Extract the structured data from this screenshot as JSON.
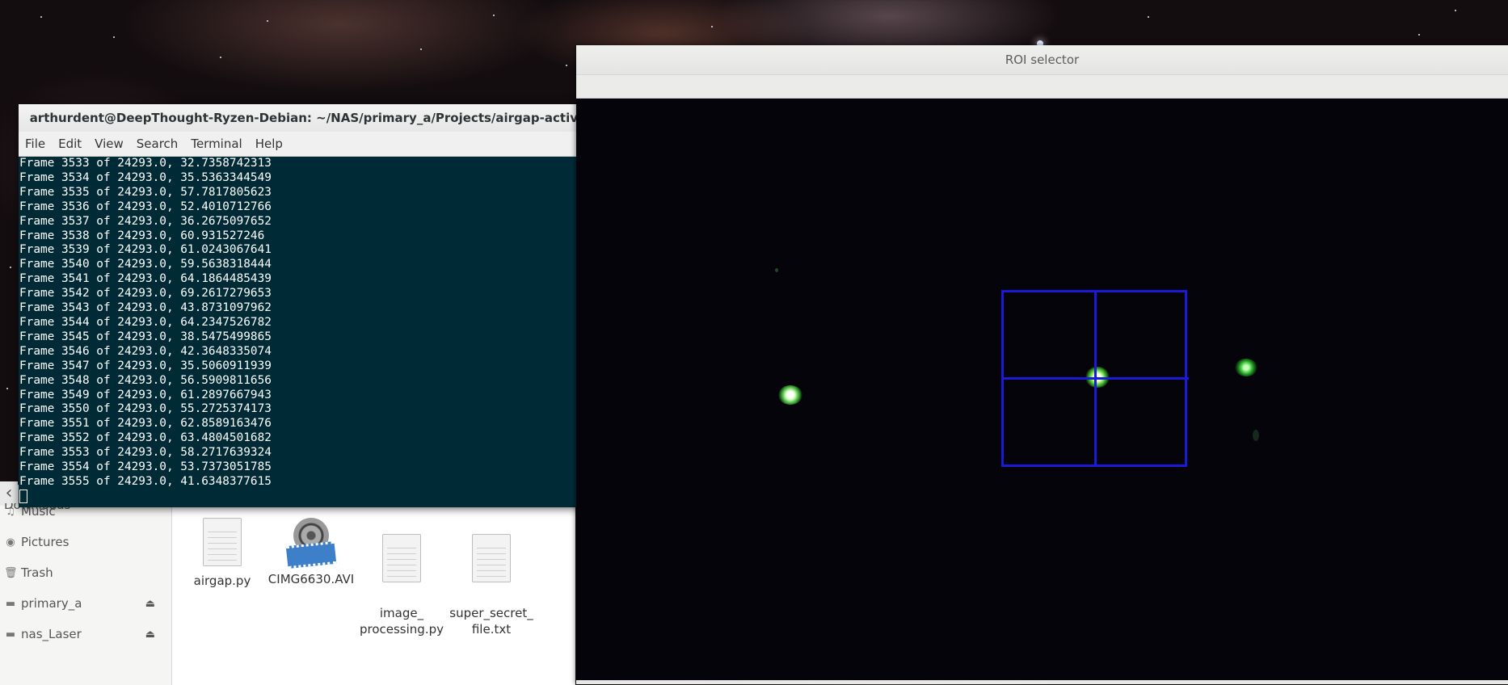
{
  "terminal": {
    "title": "arthurdent@DeepThought-Ryzen-Debian: ~/NAS/primary_a/Projects/airgap-activity-light/files",
    "close_glyph": "×",
    "menu": [
      "File",
      "Edit",
      "View",
      "Search",
      "Terminal",
      "Help"
    ],
    "lines": [
      "Frame 3533 of 24293.0, 32.7358742313",
      "Frame 3534 of 24293.0, 35.5363344549",
      "Frame 3535 of 24293.0, 57.7817805623",
      "Frame 3536 of 24293.0, 52.4010712766",
      "Frame 3537 of 24293.0, 36.2675097652",
      "Frame 3538 of 24293.0, 60.931527246",
      "Frame 3539 of 24293.0, 61.0243067641",
      "Frame 3540 of 24293.0, 59.5638318444",
      "Frame 3541 of 24293.0, 64.1864485439",
      "Frame 3542 of 24293.0, 69.2617279653",
      "Frame 3543 of 24293.0, 43.8731097962",
      "Frame 3544 of 24293.0, 64.2347526782",
      "Frame 3545 of 24293.0, 38.5475499865",
      "Frame 3546 of 24293.0, 42.3648335074",
      "Frame 3547 of 24293.0, 35.5060911939",
      "Frame 3548 of 24293.0, 56.5909811656",
      "Frame 3549 of 24293.0, 61.2897667943",
      "Frame 3550 of 24293.0, 55.2725374173",
      "Frame 3551 of 24293.0, 62.8589163476",
      "Frame 3552 of 24293.0, 63.4804501682",
      "Frame 3553 of 24293.0, 58.2717639324",
      "Frame 3554 of 24293.0, 53.7373051785",
      "Frame 3555 of 24293.0, 41.6348377615"
    ]
  },
  "file_manager": {
    "sidebar": [
      {
        "label": "Downloads",
        "icon": "download-icon"
      },
      {
        "label": "Music",
        "icon": "music-icon"
      },
      {
        "label": "Pictures",
        "icon": "camera-icon"
      },
      {
        "label": "Trash",
        "icon": "trash-icon"
      },
      {
        "label": "primary_a",
        "icon": "drive-icon",
        "eject": "⏏"
      },
      {
        "label": "nas_Laser",
        "icon": "drive-icon",
        "eject": "⏏"
      }
    ],
    "files": [
      {
        "name": "airgap.py",
        "icon": "text-file-icon"
      },
      {
        "name": "CIMG6630.AVI",
        "icon": "video-file-icon"
      },
      {
        "name": "image_\nprocessing.py",
        "icon": "text-file-icon"
      },
      {
        "name": "super_secret_\nfile.txt",
        "icon": "text-file-icon"
      }
    ]
  },
  "roi_window": {
    "title": "ROI selector",
    "roi_color": "#1a1ad8"
  },
  "colors": {
    "terminal_bg": "#002b36",
    "terminal_text": "#ffffff"
  }
}
